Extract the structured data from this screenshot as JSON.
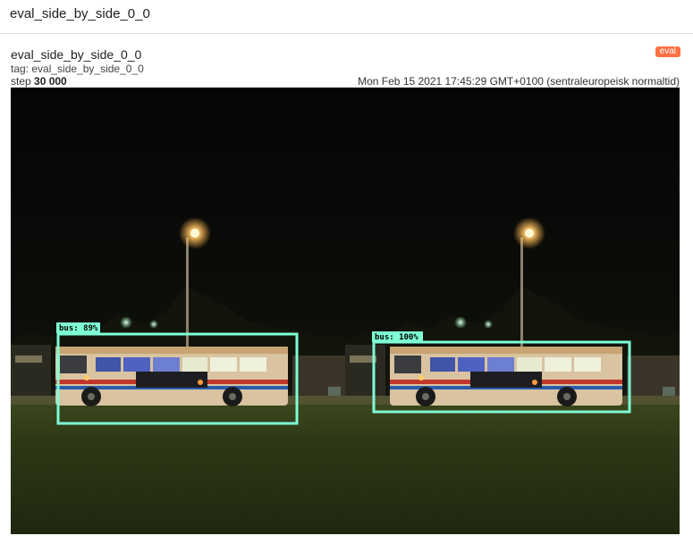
{
  "header": {
    "title": "eval_side_by_side_0_0"
  },
  "card": {
    "title": "eval_side_by_side_0_0",
    "run_badge": "eval",
    "tag_prefix": "tag:",
    "tag_value": "eval_side_by_side_0_0",
    "step_prefix": "step",
    "step_value": "30 000",
    "timestamp": "Mon Feb 15 2021 17:45:29 GMT+0100 (sentraleuropeisk normaltid)"
  },
  "image": {
    "description_icon": "image-icon",
    "left_panel": {
      "detection_label": "bus:  89%"
    },
    "right_panel": {
      "detection_label": "bus:  100%"
    },
    "box_color": "#7fffd4"
  },
  "colors": {
    "badge": "#ff7043",
    "divider": "#dcdcdc"
  }
}
